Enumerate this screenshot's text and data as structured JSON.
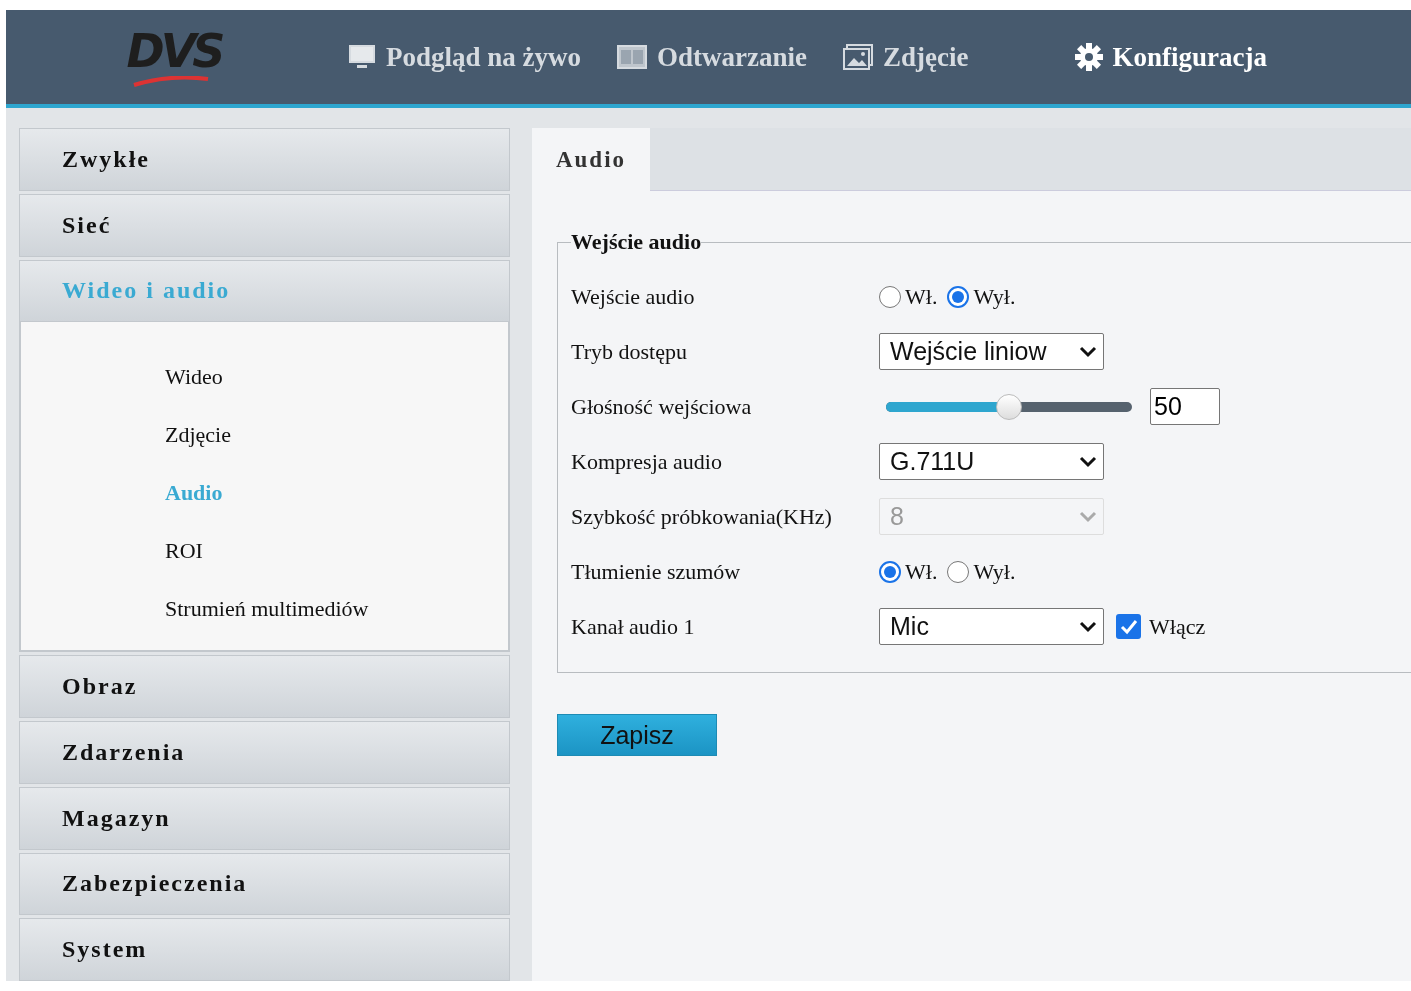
{
  "header": {
    "logo": "DVS",
    "nav": [
      {
        "label": "Podgląd na żywo",
        "selected": false
      },
      {
        "label": "Odtwarzanie",
        "selected": false
      },
      {
        "label": "Zdjęcie",
        "selected": false
      },
      {
        "label": "Konfiguracja",
        "selected": true
      }
    ]
  },
  "sidebar": {
    "groups": [
      {
        "label": "Zwykłe",
        "expanded": false
      },
      {
        "label": "Sieć",
        "expanded": false
      },
      {
        "label": "Wideo i audio",
        "expanded": true,
        "children": [
          {
            "label": "Wideo",
            "selected": false
          },
          {
            "label": "Zdjęcie",
            "selected": false
          },
          {
            "label": "Audio",
            "selected": true
          },
          {
            "label": "ROI",
            "selected": false
          },
          {
            "label": "Strumień multimediów",
            "selected": false
          }
        ]
      },
      {
        "label": "Obraz",
        "expanded": false
      },
      {
        "label": "Zdarzenia",
        "expanded": false
      },
      {
        "label": "Magazyn",
        "expanded": false
      },
      {
        "label": "Zabezpieczenia",
        "expanded": false
      },
      {
        "label": "System",
        "expanded": false
      }
    ]
  },
  "content": {
    "tabs": [
      {
        "label": "Audio",
        "selected": true
      }
    ],
    "fieldset": {
      "legend": "Wejście audio",
      "rows": [
        {
          "kind": "radio",
          "label": "Wejście audio",
          "options": [
            {
              "label": "Wł.",
              "selected": false
            },
            {
              "label": "Wył.",
              "selected": true
            }
          ]
        },
        {
          "kind": "select",
          "label": "Tryb dostępu",
          "value": "Wejście liniow",
          "disabled": false
        },
        {
          "kind": "slider",
          "label": "Głośność wejściowa",
          "level": 0.5,
          "value": "50"
        },
        {
          "kind": "select",
          "label": "Kompresja audio",
          "value": "G.711U",
          "disabled": false
        },
        {
          "kind": "select",
          "label": "Szybkość próbkowania(KHz)",
          "value": "8",
          "disabled": true
        },
        {
          "kind": "radio",
          "label": "Tłumienie szumów",
          "options": [
            {
              "label": "Wł.",
              "selected": true
            },
            {
              "label": "Wył.",
              "selected": false
            }
          ]
        },
        {
          "kind": "select",
          "label": "Kanał audio 1",
          "value": "Mic",
          "disabled": false,
          "checkbox": {
            "label": "Włącz",
            "checked": true
          }
        }
      ]
    },
    "save_button": "Zapisz"
  }
}
